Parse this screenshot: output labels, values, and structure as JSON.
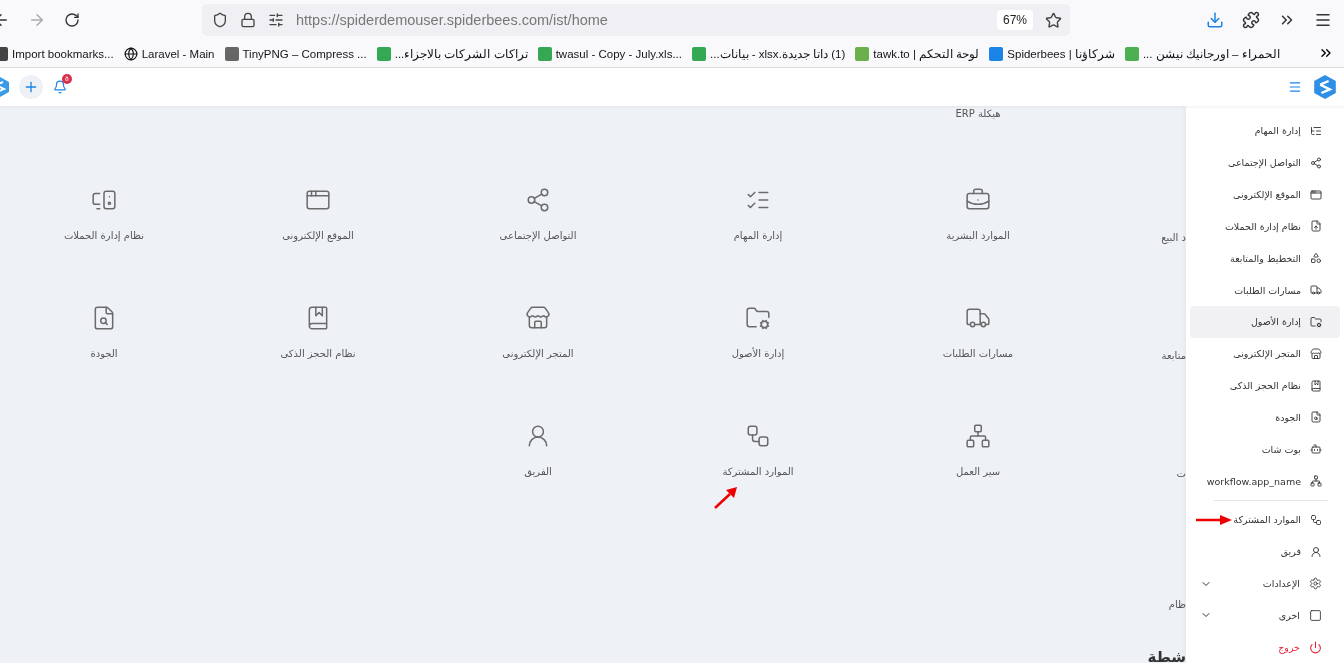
{
  "browser": {
    "url": "https://spiderdemouser.spiderbees.com/ist/home",
    "zoom": "67%"
  },
  "bookmarks": [
    "الحمراء – اورجانيك نيشن ...",
    "Spiderbees | شركاؤنا",
    "tawk.to | لوحة التحكم",
    "(1) داتا جديدة.xlsx - بيانات...",
    "twasul - Copy - July.xls...",
    "تراكات الشركات بالاجزاء...",
    "TinyPNG – Compress ...",
    "Laravel - Main",
    "Import bookmarks..."
  ],
  "header": {
    "notification_count": "٥"
  },
  "apps_grid": {
    "top_label": "هيكلة ERP",
    "rows": [
      [
        {
          "label": "الموارد البشرية",
          "annotated": false
        },
        {
          "label": "إدارة المهام",
          "annotated": false
        },
        {
          "label": "التواصل الإجتماعى",
          "annotated": false
        },
        {
          "label": "الموقع الإلكترونى",
          "annotated": false
        },
        {
          "label": "نظام إدارة الحملات",
          "annotated": false
        }
      ],
      [
        {
          "label": "مسارات الطلبات",
          "annotated": false
        },
        {
          "label": "إدارة الأصول",
          "annotated": false
        },
        {
          "label": "المتجر الإلكترونى",
          "annotated": false
        },
        {
          "label": "نظام الحجز الذكى",
          "annotated": false
        },
        {
          "label": "الجودة",
          "annotated": false
        }
      ],
      [
        {
          "label": "سير العمل",
          "annotated": false
        },
        {
          "label": "الموارد المشتركة",
          "annotated": true
        },
        {
          "label": "الفريق",
          "annotated": false
        }
      ]
    ],
    "edge_labels": [
      "د البيع",
      "متابعة",
      "ت",
      "ظام"
    ],
    "edge_heading": "شطة"
  },
  "sidebar": {
    "sections": [
      [
        {
          "kind": "link",
          "label": "إدارة المهام",
          "selected": false,
          "annotated": false
        },
        {
          "kind": "link",
          "label": "التواصل الإجتماعى",
          "selected": false,
          "annotated": false
        },
        {
          "kind": "link",
          "label": "الموقع الإلكترونى",
          "selected": false,
          "annotated": false
        },
        {
          "kind": "link",
          "label": "نظام إدارة الحملات",
          "selected": false,
          "annotated": false
        },
        {
          "kind": "link",
          "label": "التخطيط والمتابعة",
          "selected": false,
          "annotated": false
        },
        {
          "kind": "link",
          "label": "مسارات الطلبات",
          "selected": false,
          "annotated": false
        },
        {
          "kind": "link",
          "label": "إدارة الأصول",
          "selected": true,
          "annotated": false
        },
        {
          "kind": "link",
          "label": "المتجر الإلكترونى",
          "selected": false,
          "annotated": false
        },
        {
          "kind": "link",
          "label": "نظام الحجز الذكى",
          "selected": false,
          "annotated": false
        },
        {
          "kind": "link",
          "label": "الجودة",
          "selected": false,
          "annotated": false
        },
        {
          "kind": "link",
          "label": "بوت شات",
          "selected": false,
          "annotated": false
        },
        {
          "kind": "link",
          "label": "workflow.app_name",
          "selected": false,
          "annotated": false
        }
      ],
      [
        {
          "kind": "link",
          "label": "الموارد المشتركة",
          "selected": false,
          "annotated": true
        },
        {
          "kind": "link",
          "label": "فريق",
          "selected": false,
          "annotated": false
        },
        {
          "kind": "group",
          "label": "الإعدادات",
          "expanded": false
        },
        {
          "kind": "group",
          "label": "اخرى",
          "expanded": false
        },
        {
          "kind": "logout",
          "label": "خروج"
        }
      ]
    ]
  }
}
